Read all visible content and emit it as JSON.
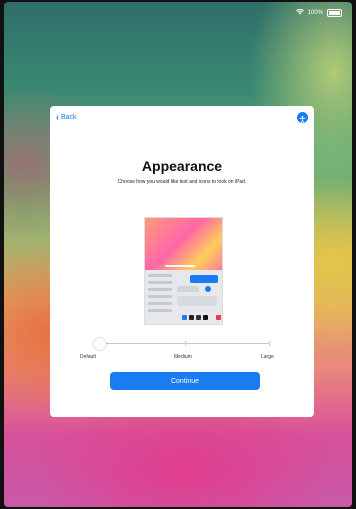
{
  "status_bar": {
    "battery_text": "100%",
    "wifi_icon": "wifi-icon",
    "battery_icon": "battery-icon"
  },
  "nav": {
    "back_label": "Back",
    "accessibility_icon": "accessibility-icon"
  },
  "title": "Appearance",
  "subtitle": "Choose how you would like text and icons to look on iPad.",
  "text_size_slider": {
    "labels": {
      "default": "Default",
      "medium": "Medium",
      "large": "Large"
    },
    "selected": "Default"
  },
  "continue_label": "Continue",
  "colors": {
    "accent": "#1a7cf2",
    "card": "#ffffff"
  }
}
